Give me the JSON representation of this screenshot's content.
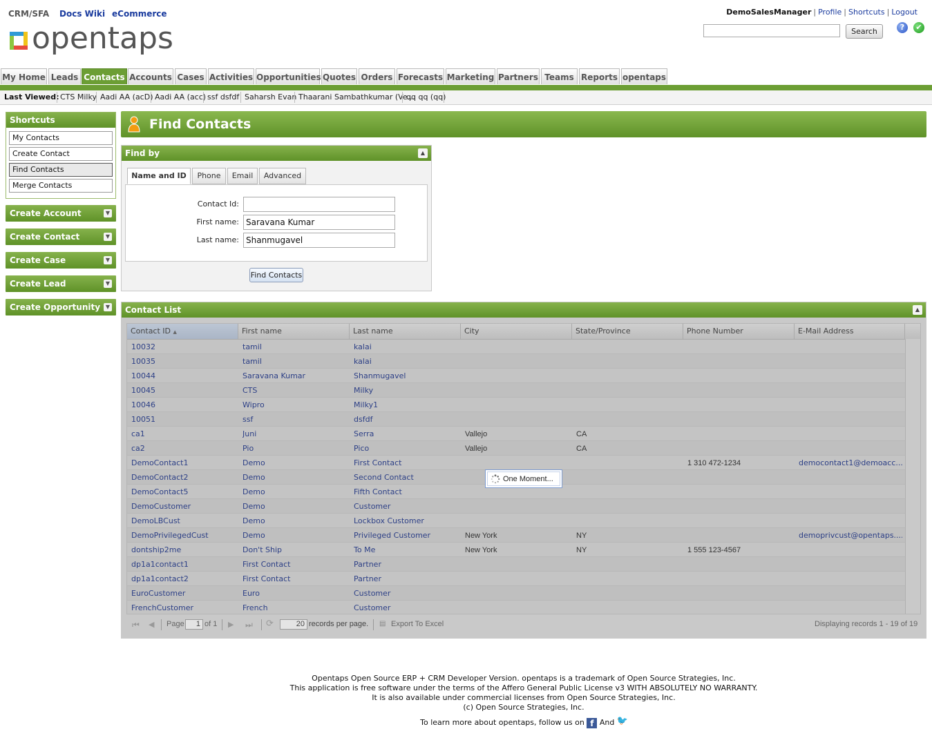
{
  "header": {
    "apps": [
      "CRM/SFA",
      "Docs Wiki",
      "eCommerce"
    ],
    "logo_text": "opentaps",
    "user": "DemoSalesManager",
    "user_links": [
      "Profile",
      "Shortcuts",
      "Logout"
    ],
    "search_value": "",
    "search_button": "Search",
    "help_icon_glyph": "?",
    "ok_icon_glyph": "✔"
  },
  "nav": {
    "tabs": [
      "My Home",
      "Leads",
      "Contacts",
      "Accounts",
      "Cases",
      "Activities",
      "Opportunities",
      "Quotes",
      "Orders",
      "Forecasts",
      "Marketing",
      "Partners",
      "Teams",
      "Reports",
      "opentaps"
    ],
    "active": "Contacts",
    "accent_color": "#6c9e34"
  },
  "last_viewed": {
    "label": "Last Viewed:",
    "items": [
      "CTS Milky",
      "Aadi AA (acD)",
      "Aadi AA (acc)",
      "ssf dsfdf",
      "Saharsh Evan",
      "Thaarani Sambathkumar (Ve...",
      "qq qq (qq)"
    ]
  },
  "shortcuts": {
    "title": "Shortcuts",
    "items": [
      "My Contacts",
      "Create Contact",
      "Find Contacts",
      "Merge Contacts"
    ],
    "selected": "Find Contacts"
  },
  "create_buttons": [
    "Create Account",
    "Create Contact",
    "Create Case",
    "Create Lead",
    "Create Opportunity"
  ],
  "page_title": "Find Contacts",
  "find_by": {
    "title": "Find by",
    "tabs": [
      "Name and ID",
      "Phone",
      "Email",
      "Advanced"
    ],
    "active_tab": "Name and ID",
    "fields": {
      "contact_id": {
        "label": "Contact Id:",
        "value": ""
      },
      "first_name": {
        "label": "First name:",
        "value": "Saravana Kumar"
      },
      "last_name": {
        "label": "Last name:",
        "value": "Shanmugavel"
      }
    },
    "submit": "Find Contacts"
  },
  "contact_list": {
    "title": "Contact List",
    "columns": [
      "Contact ID",
      "First name",
      "Last name",
      "City",
      "State/Province",
      "Phone Number",
      "E-Mail Address"
    ],
    "sort_indicator": "▲",
    "rows": [
      [
        "10032",
        "tamil",
        "kalai",
        "",
        "",
        "",
        ""
      ],
      [
        "10035",
        "tamil",
        "kalai",
        "",
        "",
        "",
        ""
      ],
      [
        "10044",
        "Saravana Kumar",
        "Shanmugavel",
        "",
        "",
        "",
        ""
      ],
      [
        "10045",
        "CTS",
        "Milky",
        "",
        "",
        "",
        ""
      ],
      [
        "10046",
        "Wipro",
        "Milky1",
        "",
        "",
        "",
        ""
      ],
      [
        "10051",
        "ssf",
        "dsfdf",
        "",
        "",
        "",
        ""
      ],
      [
        "ca1",
        "Juni",
        "Serra",
        "Vallejo",
        "CA",
        "",
        ""
      ],
      [
        "ca2",
        "Pio",
        "Pico",
        "Vallejo",
        "CA",
        "",
        ""
      ],
      [
        "DemoContact1",
        "Demo",
        "First Contact",
        "",
        "",
        "1 310 472-1234",
        "democontact1@demoacc..."
      ],
      [
        "DemoContact2",
        "Demo",
        "Second Contact",
        "",
        "",
        "",
        ""
      ],
      [
        "DemoContact5",
        "Demo",
        "Fifth Contact",
        "",
        "",
        "",
        ""
      ],
      [
        "DemoCustomer",
        "Demo",
        "Customer",
        "",
        "",
        "",
        ""
      ],
      [
        "DemoLBCust",
        "Demo",
        "Lockbox Customer",
        "",
        "",
        "",
        ""
      ],
      [
        "DemoPrivilegedCust",
        "Demo",
        "Privileged Customer",
        "New York",
        "NY",
        "",
        "demoprivcust@opentaps...."
      ],
      [
        "dontship2me",
        "Don't Ship",
        "To Me",
        "New York",
        "NY",
        "1 555 123-4567",
        ""
      ],
      [
        "dp1a1contact1",
        "First Contact",
        "Partner",
        "",
        "",
        "",
        ""
      ],
      [
        "dp1a1contact2",
        "First Contact",
        "Partner",
        "",
        "",
        "",
        ""
      ],
      [
        "EuroCustomer",
        "Euro",
        "Customer",
        "",
        "",
        "",
        ""
      ],
      [
        "FrenchCustomer",
        "French",
        "Customer",
        "",
        "",
        "",
        ""
      ]
    ],
    "pager": {
      "page_label": "Page",
      "page_value": "1",
      "of_label": "of 1",
      "page_size": "20",
      "records_per_page": "records per page.",
      "export": "Export To Excel",
      "displaying": "Displaying records 1 - 19 of 19"
    },
    "loading": "One Moment..."
  },
  "footer": {
    "lines": [
      "Opentaps Open Source ERP + CRM Developer Version. opentaps is a trademark of Open Source Strategies, Inc.",
      "This application is free software under the terms of the Affero General Public License v3 WITH ABSOLUTELY NO WARRANTY.",
      "It is also available under commercial licenses from Open Source Strategies, Inc.",
      "(c) Open Source Strategies, Inc."
    ],
    "follow_text": "To learn more about opentaps, follow us on",
    "and_text": "And",
    "facebook_glyph": "f",
    "twitter_glyph": "🐦"
  }
}
